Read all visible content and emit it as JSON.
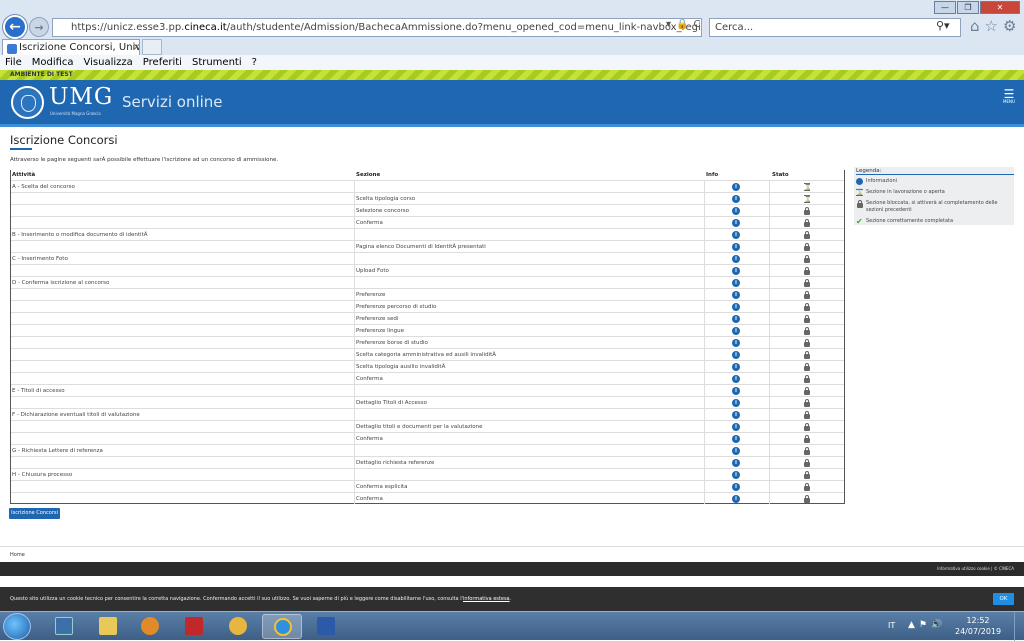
{
  "browser": {
    "url_prefix": "https://unicz.esse3.pp.",
    "url_domain": "cineca.it",
    "url_rest": "/auth/studente/Admission/BachecaAmmissione.do?menu_opened_cod=menu_link-navbox_registrato_Segreteria",
    "search_placeholder": "Cerca...",
    "tab_title": "Iscrizione Concorsi, Univers...",
    "menu": [
      "File",
      "Modifica",
      "Visualizza",
      "Preferiti",
      "Strumenti",
      "?"
    ]
  },
  "test_banner": "AMBIENTE DI TEST",
  "header": {
    "logo_text": "UMG",
    "logo_sub": "Università Magna Græcia",
    "site_title": "Servizi online",
    "menu_label": "MENU"
  },
  "page": {
    "title": "Iscrizione Concorsi",
    "intro": "Attraverso le pagine seguenti sarÃ  possibile effettuare l'iscrizione ad un concorso di ammissione.",
    "columns": {
      "activity": "Attività",
      "section": "Sezione",
      "info": "Info",
      "status": "Stato"
    },
    "rows": [
      {
        "activity": "A - Scelta del concorso",
        "section": "",
        "info": true,
        "status": "hourglass"
      },
      {
        "activity": "",
        "section": "Scelta tipologia corso",
        "info": true,
        "status": "hourglass"
      },
      {
        "activity": "",
        "section": "Selezione concorso",
        "info": true,
        "status": "lock"
      },
      {
        "activity": "",
        "section": "Conferma",
        "info": true,
        "status": "lock"
      },
      {
        "activity": "B - Inserimento o modifica documento di identitÃ",
        "section": "",
        "info": true,
        "status": "lock"
      },
      {
        "activity": "",
        "section": "Pagina elenco Documenti di IdentitÃ  presentati",
        "info": true,
        "status": "lock"
      },
      {
        "activity": "C - Inserimento Foto",
        "section": "",
        "info": true,
        "status": "lock"
      },
      {
        "activity": "",
        "section": "Upload Foto",
        "info": true,
        "status": "lock"
      },
      {
        "activity": "D - Conferma iscrizione al concorso",
        "section": "",
        "info": true,
        "status": "lock"
      },
      {
        "activity": "",
        "section": "Preferenze",
        "info": true,
        "status": "lock"
      },
      {
        "activity": "",
        "section": "Preferenze percorso di studio",
        "info": true,
        "status": "lock"
      },
      {
        "activity": "",
        "section": "Preferenze sedi",
        "info": true,
        "status": "lock"
      },
      {
        "activity": "",
        "section": "Preferenze lingue",
        "info": true,
        "status": "lock"
      },
      {
        "activity": "",
        "section": "Preferenze borse di studio",
        "info": true,
        "status": "lock"
      },
      {
        "activity": "",
        "section": "Scelta categoria amministrativa ed ausili invaliditÃ",
        "info": true,
        "status": "lock"
      },
      {
        "activity": "",
        "section": "Scelta tipologia ausilio invaliditÃ",
        "info": true,
        "status": "lock"
      },
      {
        "activity": "",
        "section": "Conferma",
        "info": true,
        "status": "lock"
      },
      {
        "activity": "E - Titoli di accesso",
        "section": "",
        "info": true,
        "status": "lock"
      },
      {
        "activity": "",
        "section": "Dettaglio Titoli di Accesso",
        "info": true,
        "status": "lock"
      },
      {
        "activity": "F - Dichiarazione eventuali titoli di valutazione",
        "section": "",
        "info": true,
        "status": "lock"
      },
      {
        "activity": "",
        "section": "Dettaglio titoli e documenti per la valutazione",
        "info": true,
        "status": "lock"
      },
      {
        "activity": "",
        "section": "Conferma",
        "info": true,
        "status": "lock"
      },
      {
        "activity": "G - Richiesta Lettere di referenza",
        "section": "",
        "info": true,
        "status": "lock"
      },
      {
        "activity": "",
        "section": "Dettaglio richiesta referenze",
        "info": true,
        "status": "lock"
      },
      {
        "activity": "H - Chiusura processo",
        "section": "",
        "info": true,
        "status": "lock"
      },
      {
        "activity": "",
        "section": "Conferma esplicita",
        "info": true,
        "status": "lock"
      },
      {
        "activity": "",
        "section": "Conferma",
        "info": true,
        "status": "lock"
      }
    ],
    "legend": {
      "title": "Legenda:",
      "items": [
        {
          "icon": "info-icon",
          "text": "Informazioni"
        },
        {
          "icon": "hourglass-icon",
          "text": "Sezione in lavorazione o aperta"
        },
        {
          "icon": "lock-icon",
          "text": "Sezione bloccata, si attiverà al completamento delle sezioni precedenti"
        },
        {
          "icon": "checkmark-icon",
          "text": "Sezione correttamente completata"
        }
      ]
    },
    "button_label": "Iscrizione Concorsi",
    "home_link": "Home"
  },
  "footer": {
    "links": "Informativa utilizzo cookie | © CINECA"
  },
  "cookie": {
    "text": "Questo sito utilizza un cookie tecnico per consentire la corretta navigazione. Confermando accetti il suo utilizzo. Se vuoi saperne di più e leggere come disabilitarne l'uso, consulta l'",
    "link": "informativa estesa",
    "ok": "OK"
  },
  "taskbar": {
    "lang": "IT",
    "time": "12:52",
    "date": "24/07/2019"
  },
  "colors": {
    "brand": "#1f67b1",
    "test_banner": "#c6e23a"
  }
}
